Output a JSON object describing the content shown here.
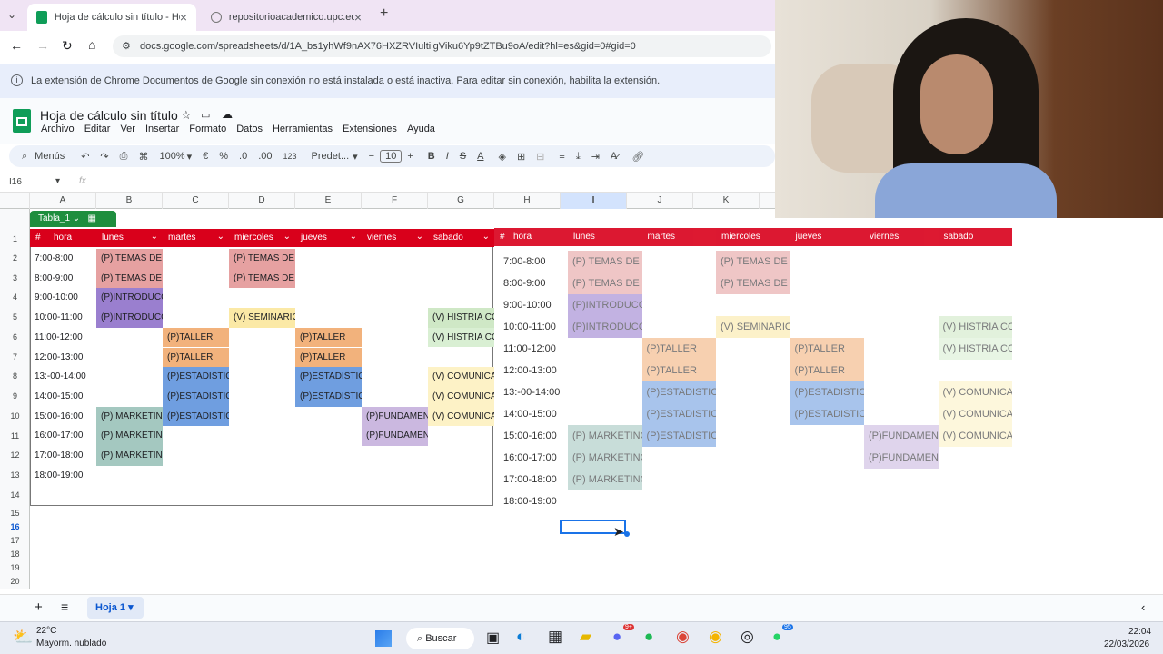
{
  "browser": {
    "tabs": [
      {
        "title": "Hoja de cálculo sin título - Hoja"
      },
      {
        "title": "repositorioacademico.upc.edu.p"
      }
    ],
    "url": "docs.google.com/spreadsheets/d/1A_bs1yhWf9nAX76HXZRVIultiigViku6Yp9tZTBu9oA/edit?hl=es&gid=0#gid=0"
  },
  "info_bar": {
    "text": "La extensión de Chrome Documentos de Google sin conexión no está instalada o está inactiva. Para editar sin conexión, habilita la extensión."
  },
  "doc": {
    "title": "Hoja de cálculo sin título",
    "menus": [
      "Archivo",
      "Editar",
      "Ver",
      "Insertar",
      "Formato",
      "Datos",
      "Herramientas",
      "Extensiones",
      "Ayuda"
    ]
  },
  "toolbar": {
    "menus_label": "Menús",
    "zoom": "100%",
    "currency": "€",
    "percent": "%",
    "dec_less": ".0",
    "dec_more": ".00",
    "number": "123",
    "font": "Predet...",
    "font_size": "10",
    "bold": "B",
    "italic": "I",
    "strike": "S",
    "text_color": "A"
  },
  "formula_bar": {
    "cell_ref": "I16",
    "fx": "fx"
  },
  "columns": [
    "A",
    "B",
    "C",
    "D",
    "E",
    "F",
    "G",
    "H",
    "I",
    "J",
    "K"
  ],
  "rows": [
    "1",
    "2",
    "3",
    "4",
    "5",
    "6",
    "7",
    "8",
    "9",
    "10",
    "11",
    "12",
    "13",
    "14",
    "15",
    "16",
    "17",
    "18",
    "19",
    "20"
  ],
  "table": {
    "name": "Tabla_1",
    "headers": [
      "#",
      "hora",
      "lunes",
      "martes",
      "miercoles",
      "jueves",
      "viernes",
      "sabado"
    ],
    "hours": [
      "7:00-8:00",
      "8:00-9:00",
      "9:00-10:00",
      "10:00-11:00",
      "11:00-12:00",
      "12:00-13:00",
      "13:-00-14:00",
      "14:00-15:00",
      "15:00-16:00",
      "16:00-17:00",
      "17:00-18:00",
      "18:00-19:00"
    ],
    "events": [
      {
        "row": 0,
        "col": 0,
        "text": "(P) TEMAS DE H",
        "color": "#e6a1a1"
      },
      {
        "row": 1,
        "col": 0,
        "text": "(P) TEMAS DE H",
        "color": "#e6a1a1"
      },
      {
        "row": 0,
        "col": 2,
        "text": "(P) TEMAS DE H",
        "color": "#e6a1a1"
      },
      {
        "row": 1,
        "col": 2,
        "text": "(P) TEMAS DE H",
        "color": "#e6a1a1"
      },
      {
        "row": 2,
        "col": 0,
        "text": "(P)INTRODUCCI",
        "color": "#9a7fcf"
      },
      {
        "row": 3,
        "col": 0,
        "text": "(P)INTRODUCCI",
        "color": "#9a7fcf"
      },
      {
        "row": 3,
        "col": 2,
        "text": "(V) SEMINARIO",
        "color": "#fbe9a6"
      },
      {
        "row": 3,
        "col": 5,
        "text": "(V) HISTRIA CO",
        "color": "#cfe8c6"
      },
      {
        "row": 4,
        "col": 5,
        "text": "(V) HISTRIA CO",
        "color": "#d9efd3"
      },
      {
        "row": 4,
        "col": 1,
        "text": "(P)TALLER",
        "color": "#f2b27c"
      },
      {
        "row": 5,
        "col": 1,
        "text": "(P)TALLER",
        "color": "#f2b27c"
      },
      {
        "row": 4,
        "col": 3,
        "text": "(P)TALLER",
        "color": "#f2b27c"
      },
      {
        "row": 5,
        "col": 3,
        "text": "(P)TALLER",
        "color": "#f2b27c"
      },
      {
        "row": 6,
        "col": 1,
        "text": "(P)ESTADISTICA",
        "color": "#6f9ee0"
      },
      {
        "row": 7,
        "col": 1,
        "text": "(P)ESTADISTICA",
        "color": "#6f9ee0"
      },
      {
        "row": 8,
        "col": 1,
        "text": "(P)ESTADISTICA",
        "color": "#6f9ee0"
      },
      {
        "row": 6,
        "col": 3,
        "text": "(P)ESTADISTICA",
        "color": "#6f9ee0"
      },
      {
        "row": 7,
        "col": 3,
        "text": "(P)ESTADISTICA",
        "color": "#6f9ee0"
      },
      {
        "row": 6,
        "col": 5,
        "text": "(V) COMUNICAC",
        "color": "#fdf2c6"
      },
      {
        "row": 7,
        "col": 5,
        "text": "(V) COMUNICAC",
        "color": "#fdf2c6"
      },
      {
        "row": 8,
        "col": 5,
        "text": "(V) COMUNICAC",
        "color": "#fdf2c6"
      },
      {
        "row": 8,
        "col": 4,
        "text": "(P)FUNDAMENT",
        "color": "#cbb8e0"
      },
      {
        "row": 9,
        "col": 4,
        "text": "(P)FUNDAMENT",
        "color": "#cbb8e0"
      },
      {
        "row": 8,
        "col": 0,
        "text": "(P) MARKETING",
        "color": "#a4c8c0"
      },
      {
        "row": 9,
        "col": 0,
        "text": "(P) MARKETING",
        "color": "#a4c8c0"
      },
      {
        "row": 10,
        "col": 0,
        "text": "(P) MARKETING",
        "color": "#a4c8c0"
      }
    ]
  },
  "sheet": {
    "name": "Hoja 1"
  },
  "weather": {
    "temp": "22°C",
    "desc": "Mayorm. nublado"
  },
  "taskbar": {
    "search": "Buscar",
    "time": "22:04",
    "date": "22/03/2026",
    "badge_discord": "9+",
    "badge_whatsapp": "95"
  },
  "colors": {
    "header_red": "#d9001b",
    "sheets_green": "#0f9d58",
    "accent_blue": "#1a73e8"
  }
}
